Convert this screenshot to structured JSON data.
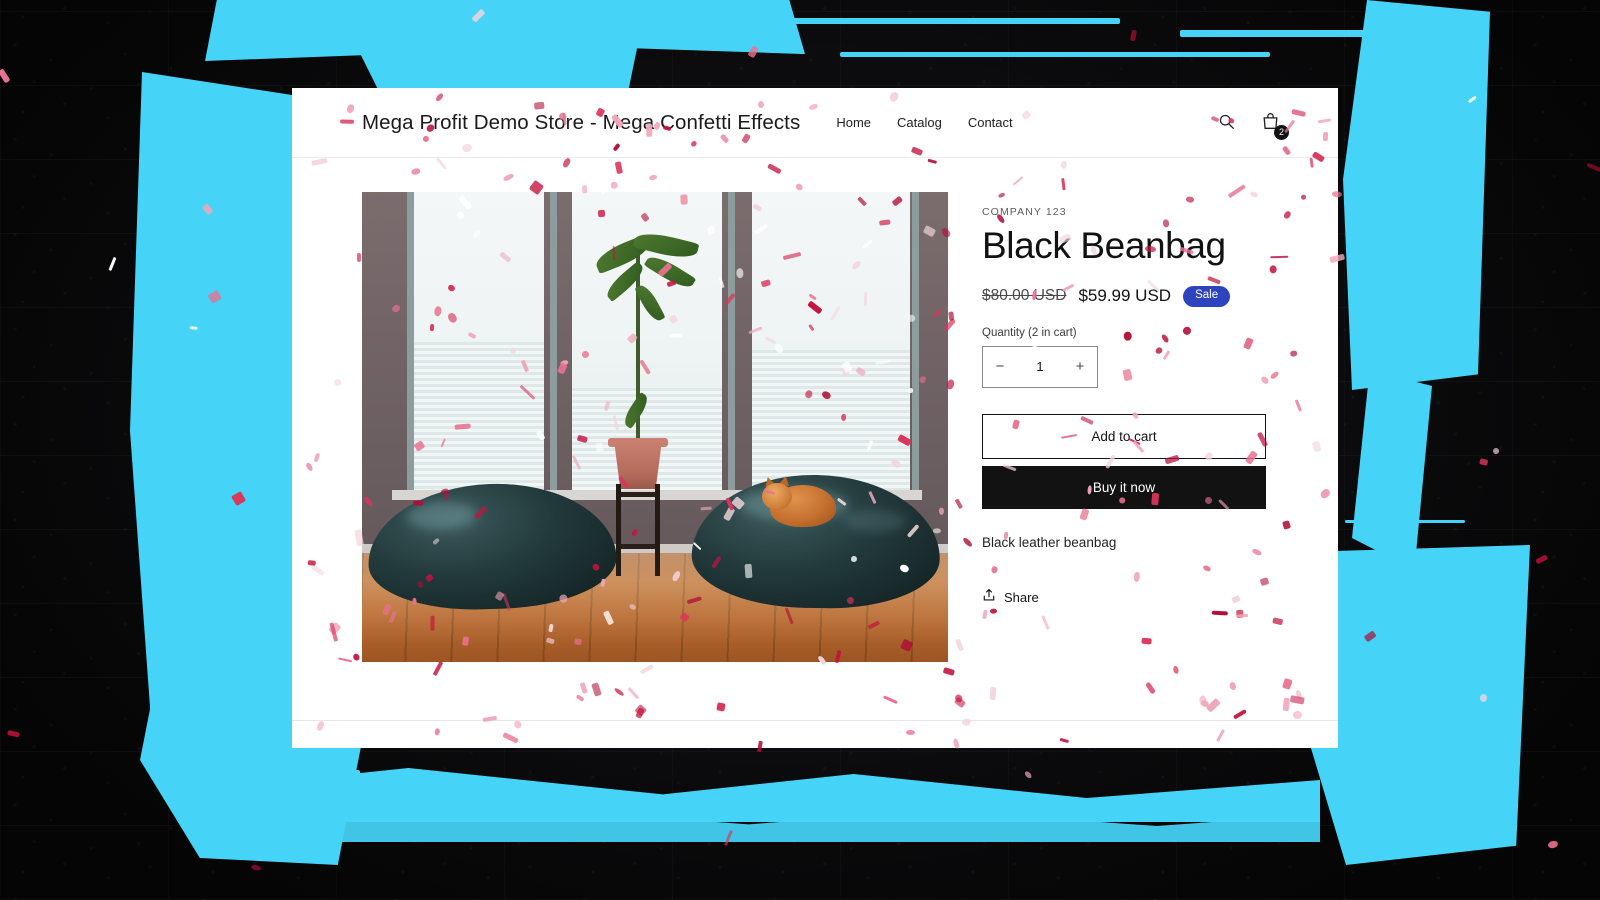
{
  "background": {
    "style": "dark-brick-wall",
    "accent_paint_color": "#45d4f7",
    "wall_color": "#0b0b0d"
  },
  "header": {
    "site_title": "Mega Profit Demo Store - Mega Confetti Effects",
    "nav": [
      {
        "label": "Home"
      },
      {
        "label": "Catalog"
      },
      {
        "label": "Contact"
      }
    ],
    "search_icon": "search-icon",
    "cart_icon": "shopping-bag-icon",
    "cart_count": "2"
  },
  "product": {
    "vendor": "COMPANY 123",
    "title": "Black Beanbag",
    "price_compare": "$80.00 USD",
    "price_current": "$59.99 USD",
    "sale_badge": "Sale",
    "sale_badge_color": "#2e44bf",
    "quantity_label": "Quantity (2 in cart)",
    "quantity_value": "1",
    "quantity_decrease": "−",
    "quantity_increase": "+",
    "add_to_cart_label": "Add to cart",
    "buy_now_label": "Buy it now",
    "buy_now_color": "#121212",
    "description": "Black leather beanbag",
    "share_label": "Share",
    "share_icon": "share-icon",
    "image_alt": "Black beanbags in a room with windows, a potted plant and an orange cat"
  }
}
